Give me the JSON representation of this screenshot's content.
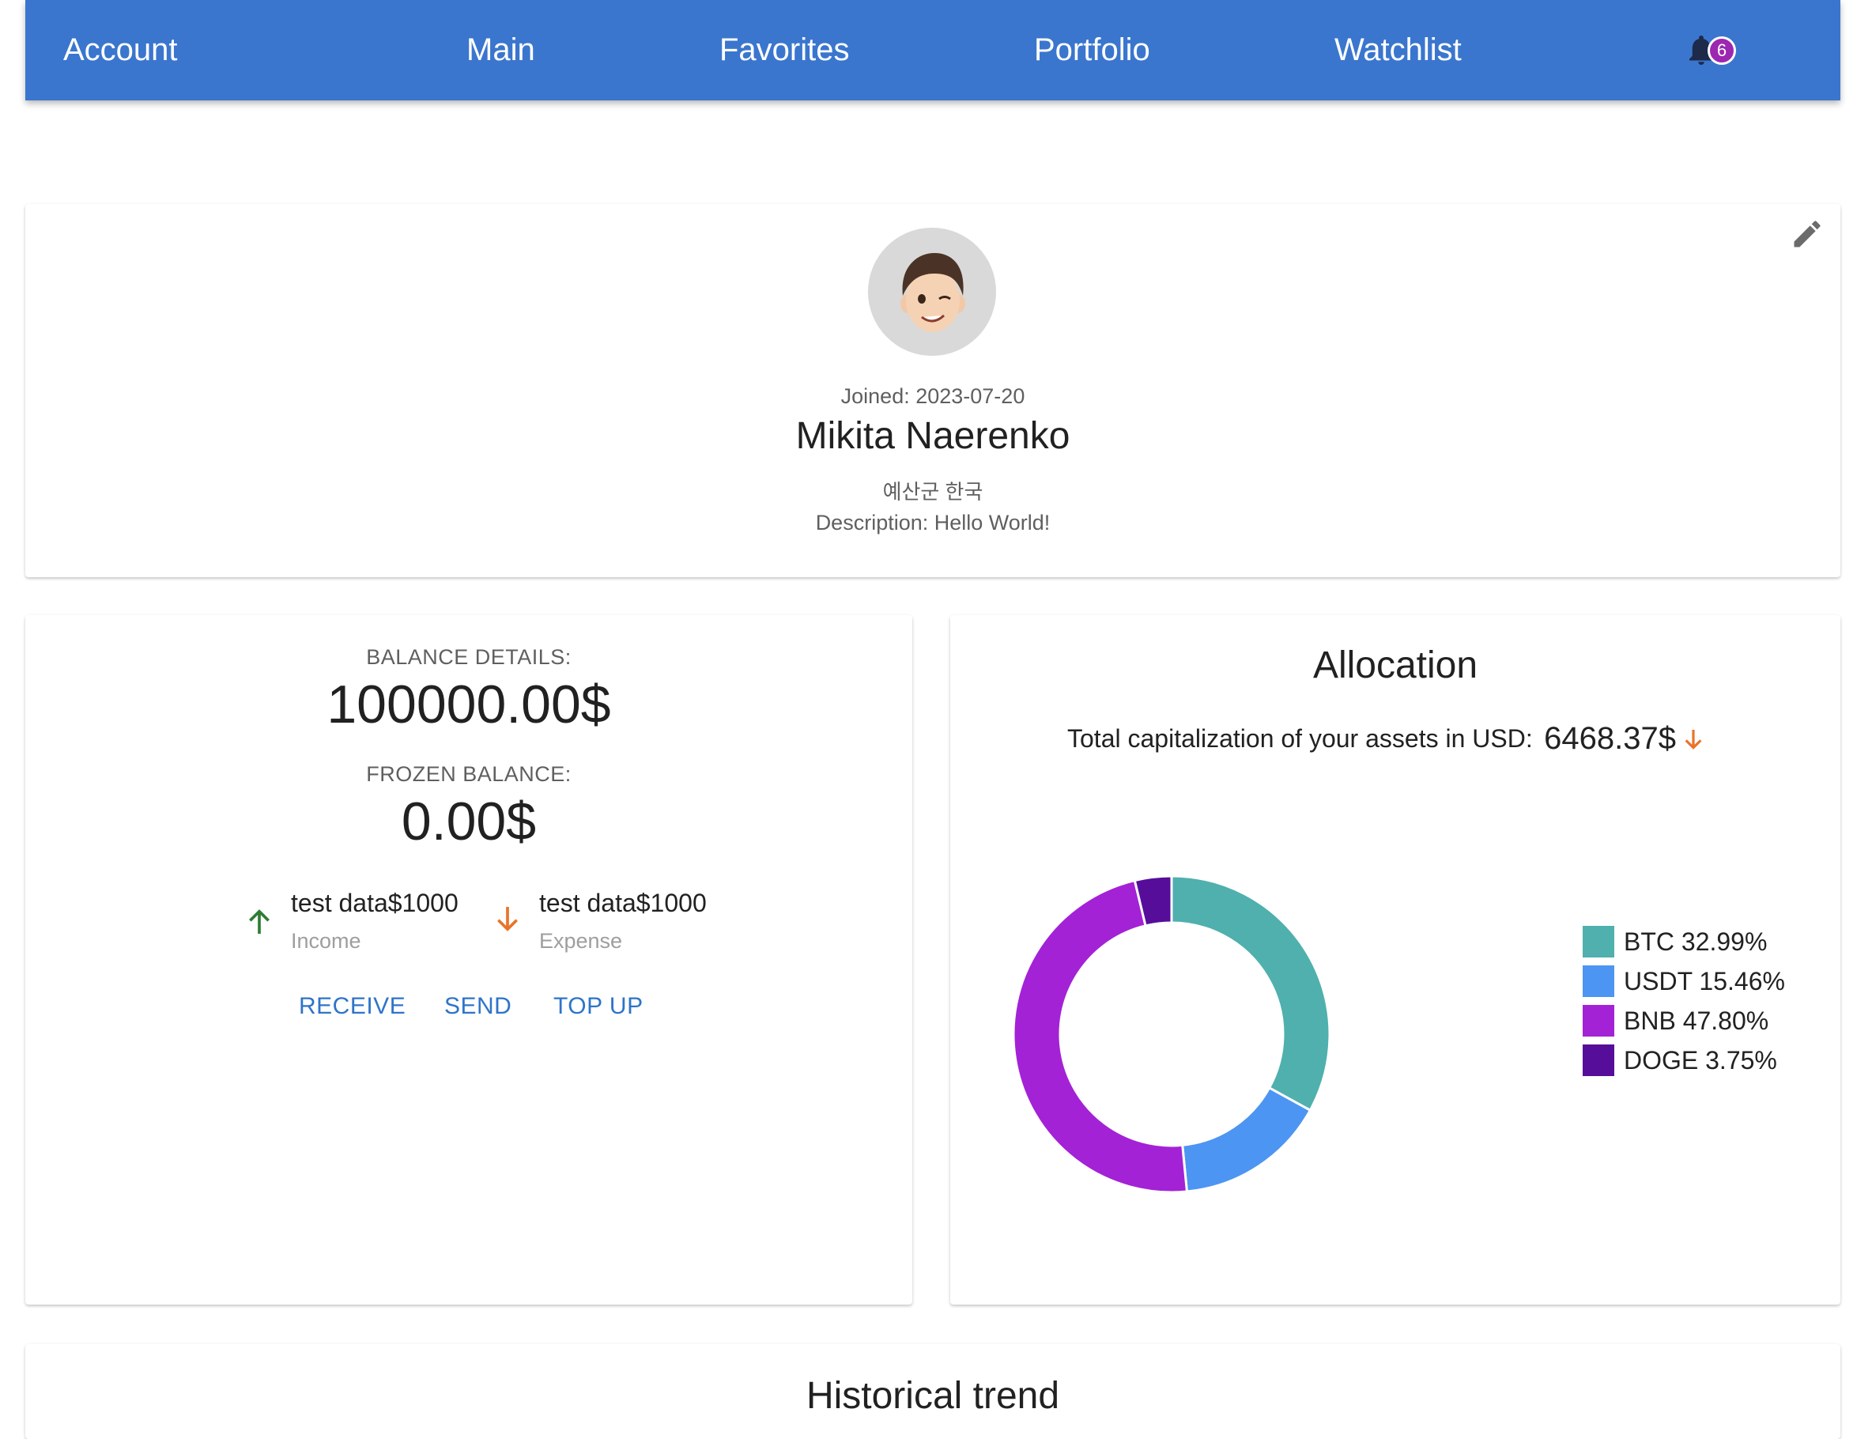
{
  "nav": {
    "items": [
      "Account",
      "Main",
      "Favorites",
      "Portfolio",
      "Watchlist"
    ],
    "notification_count": "6"
  },
  "profile": {
    "joined": "Joined: 2023-07-20",
    "name": "Mikita Naerenko",
    "location": "예산군 한국",
    "description": "Description: Hello World!"
  },
  "balance": {
    "details_label": "BALANCE DETAILS:",
    "amount": "100000.00$",
    "frozen_label": "FROZEN BALANCE:",
    "frozen_amount": "0.00$",
    "income_value": "test data$1000",
    "income_label": "Income",
    "expense_value": "test data$1000",
    "expense_label": "Expense",
    "actions": [
      "RECEIVE",
      "SEND",
      "TOP UP"
    ]
  },
  "allocation": {
    "title": "Allocation",
    "total_label": "Total capitalization of your assets in USD:",
    "total_value": "6468.37$"
  },
  "trend": {
    "title": "Historical trend"
  },
  "chart_data": {
    "type": "pie",
    "donut": true,
    "legend_position": "right",
    "categories": [
      "BTC",
      "USDT",
      "BNB",
      "DOGE"
    ],
    "values": [
      32.99,
      15.46,
      47.8,
      3.75
    ],
    "labels": [
      "BTC 32.99%",
      "USDT 15.46%",
      "BNB 47.80%",
      "DOGE 3.75%"
    ],
    "colors": [
      "#4fb0ae",
      "#4d95f2",
      "#a322d6",
      "#560e9a"
    ]
  },
  "colors": {
    "nav": "#3a76ce",
    "badge": "#9c27b0",
    "income_arrow": "#2e7d32",
    "expense_arrow": "#e8742a",
    "action": "#2e74c9"
  }
}
